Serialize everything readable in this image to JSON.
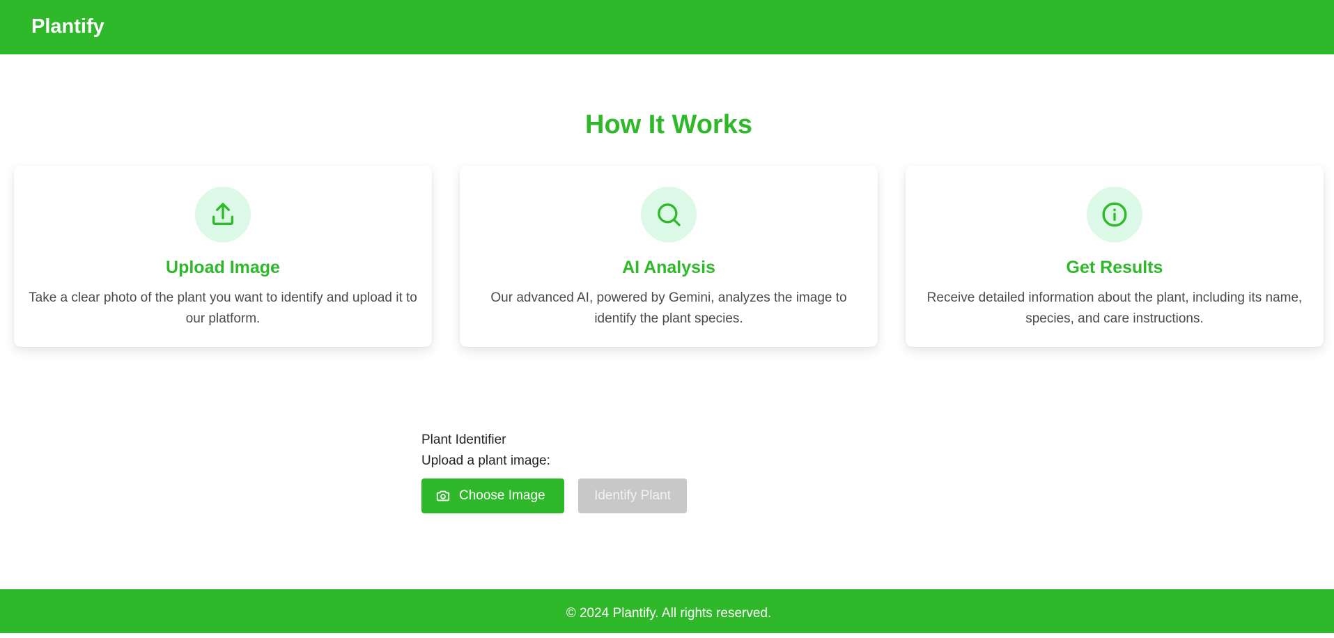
{
  "header": {
    "brand": "Plantify"
  },
  "how_it_works": {
    "title": "How It Works",
    "steps": [
      {
        "icon": "upload-icon",
        "title": "Upload Image",
        "text": "Take a clear photo of the plant you want to identify and upload it to our platform."
      },
      {
        "icon": "search-icon",
        "title": "AI Analysis",
        "text": "Our advanced AI, powered by Gemini, analyzes the image to identify the plant species."
      },
      {
        "icon": "info-icon",
        "title": "Get Results",
        "text": "Receive detailed information about the plant, including its name, species, and care instructions."
      }
    ]
  },
  "identifier": {
    "heading": "Plant Identifier",
    "upload_label": "Upload a plant image:",
    "choose_button": "Choose Image",
    "choose_icon": "camera-icon",
    "identify_button": "Identify Plant"
  },
  "footer": {
    "text": "© 2024 Plantify. All rights reserved."
  },
  "colors": {
    "brand_green": "#2eb82a",
    "icon_bg": "#dcf8e6",
    "disabled_button": "#c8c8c8"
  }
}
